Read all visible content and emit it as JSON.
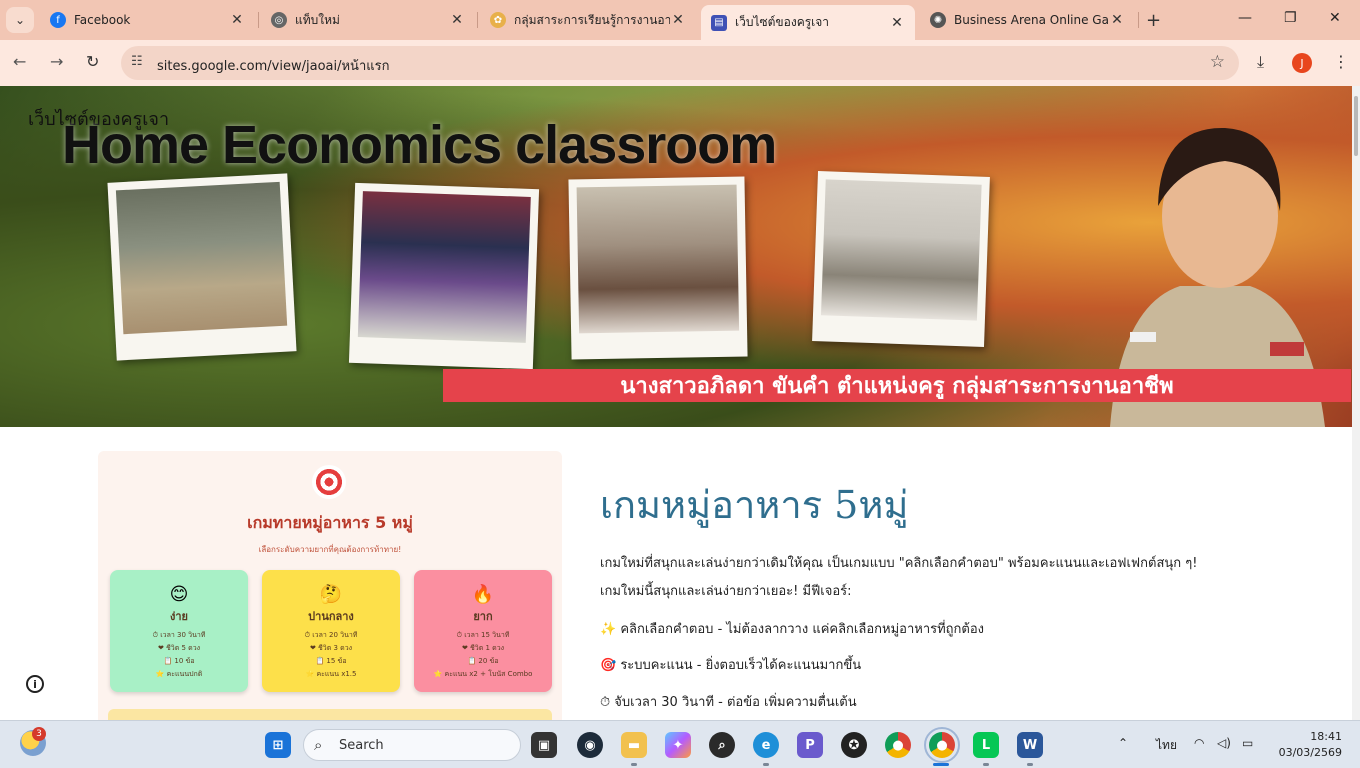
{
  "browser": {
    "tabs": [
      {
        "label": "Facebook",
        "favicon": "facebook-icon",
        "active": false
      },
      {
        "label": "แท็บใหม่",
        "favicon": "chrome-icon",
        "active": false
      },
      {
        "label": "กลุ่มสาระการเรียนรู้การงานอาชีพ",
        "favicon": "school-icon",
        "active": false
      },
      {
        "label": "เว็บไซต์ของครูเจา",
        "favicon": "sites-icon",
        "active": true
      },
      {
        "label": "Business Arena Online Game",
        "favicon": "openai-icon",
        "active": false
      }
    ],
    "url": "sites.google.com/view/jaoai/หน้าแรก",
    "profile_initial": "J"
  },
  "site": {
    "site_name": "เว็บไซต์ของครูเจา",
    "banner_title": "Home Economics classroom",
    "banner_strip": "นางสาวอภิลดา   ขันคำ  ตำแหน่งครู กลุ่มสาระการงานอาชีพ"
  },
  "game_card": {
    "title": "เกมทายหมู่อาหาร 5 หมู่",
    "subtitle": "เลือกระดับความยากที่คุณต้องการท้าทาย!",
    "levels": [
      {
        "emoji": "😊",
        "name": "ง่าย",
        "time": "⏱ เวลา 30 วินาที",
        "lives": "❤ ชีวิต 5 ดวง",
        "questions": "📋 10 ข้อ",
        "score": "⭐ คะแนนปกติ",
        "color": "#a8f0c6"
      },
      {
        "emoji": "🤔",
        "name": "ปานกลาง",
        "time": "⏱ เวลา 20 วินาที",
        "lives": "❤ ชีวิต 3 ดวง",
        "questions": "📋 15 ข้อ",
        "score": "⭐ คะแนน x1.5",
        "color": "#fde04a"
      },
      {
        "emoji": "🔥",
        "name": "ยาก",
        "time": "⏱ เวลา 15 วินาที",
        "lives": "❤ ชีวิต 1 ดวง",
        "questions": "📋 20 ข้อ",
        "score": "⭐ คะแนน x2 + โบนัส Combo",
        "color": "#fb8fa0"
      }
    ]
  },
  "article": {
    "heading": "เกมหมู่อาหาร 5หมู่",
    "intro1": "เกมใหม่ที่สนุกและเล่นง่ายกว่าเดิมให้คุณ เป็นเกมแบบ \"คลิกเลือกคำตอบ\" พร้อมคะแนนและเอฟเฟกต์สนุก ๆ!",
    "intro2": "เกมใหม่นี้สนุกและเล่นง่ายกว่าเยอะ! มีฟีเจอร์:",
    "features": [
      "✨  คลิกเลือกคำตอบ - ไม่ต้องลากวาง แค่คลิกเลือกหมู่อาหารที่ถูกต้อง",
      "🎯  ระบบคะแนน - ยิ่งตอบเร็วได้คะแนนมากขึ้น",
      "⏱  จับเวลา 30 วินาที - ต่อข้อ เพิ่มความตื่นเต้น"
    ]
  },
  "taskbar": {
    "search_label": "Search",
    "weather_badge": "3",
    "language": "ไทย",
    "time": "18:41",
    "date": "03/03/2569"
  }
}
